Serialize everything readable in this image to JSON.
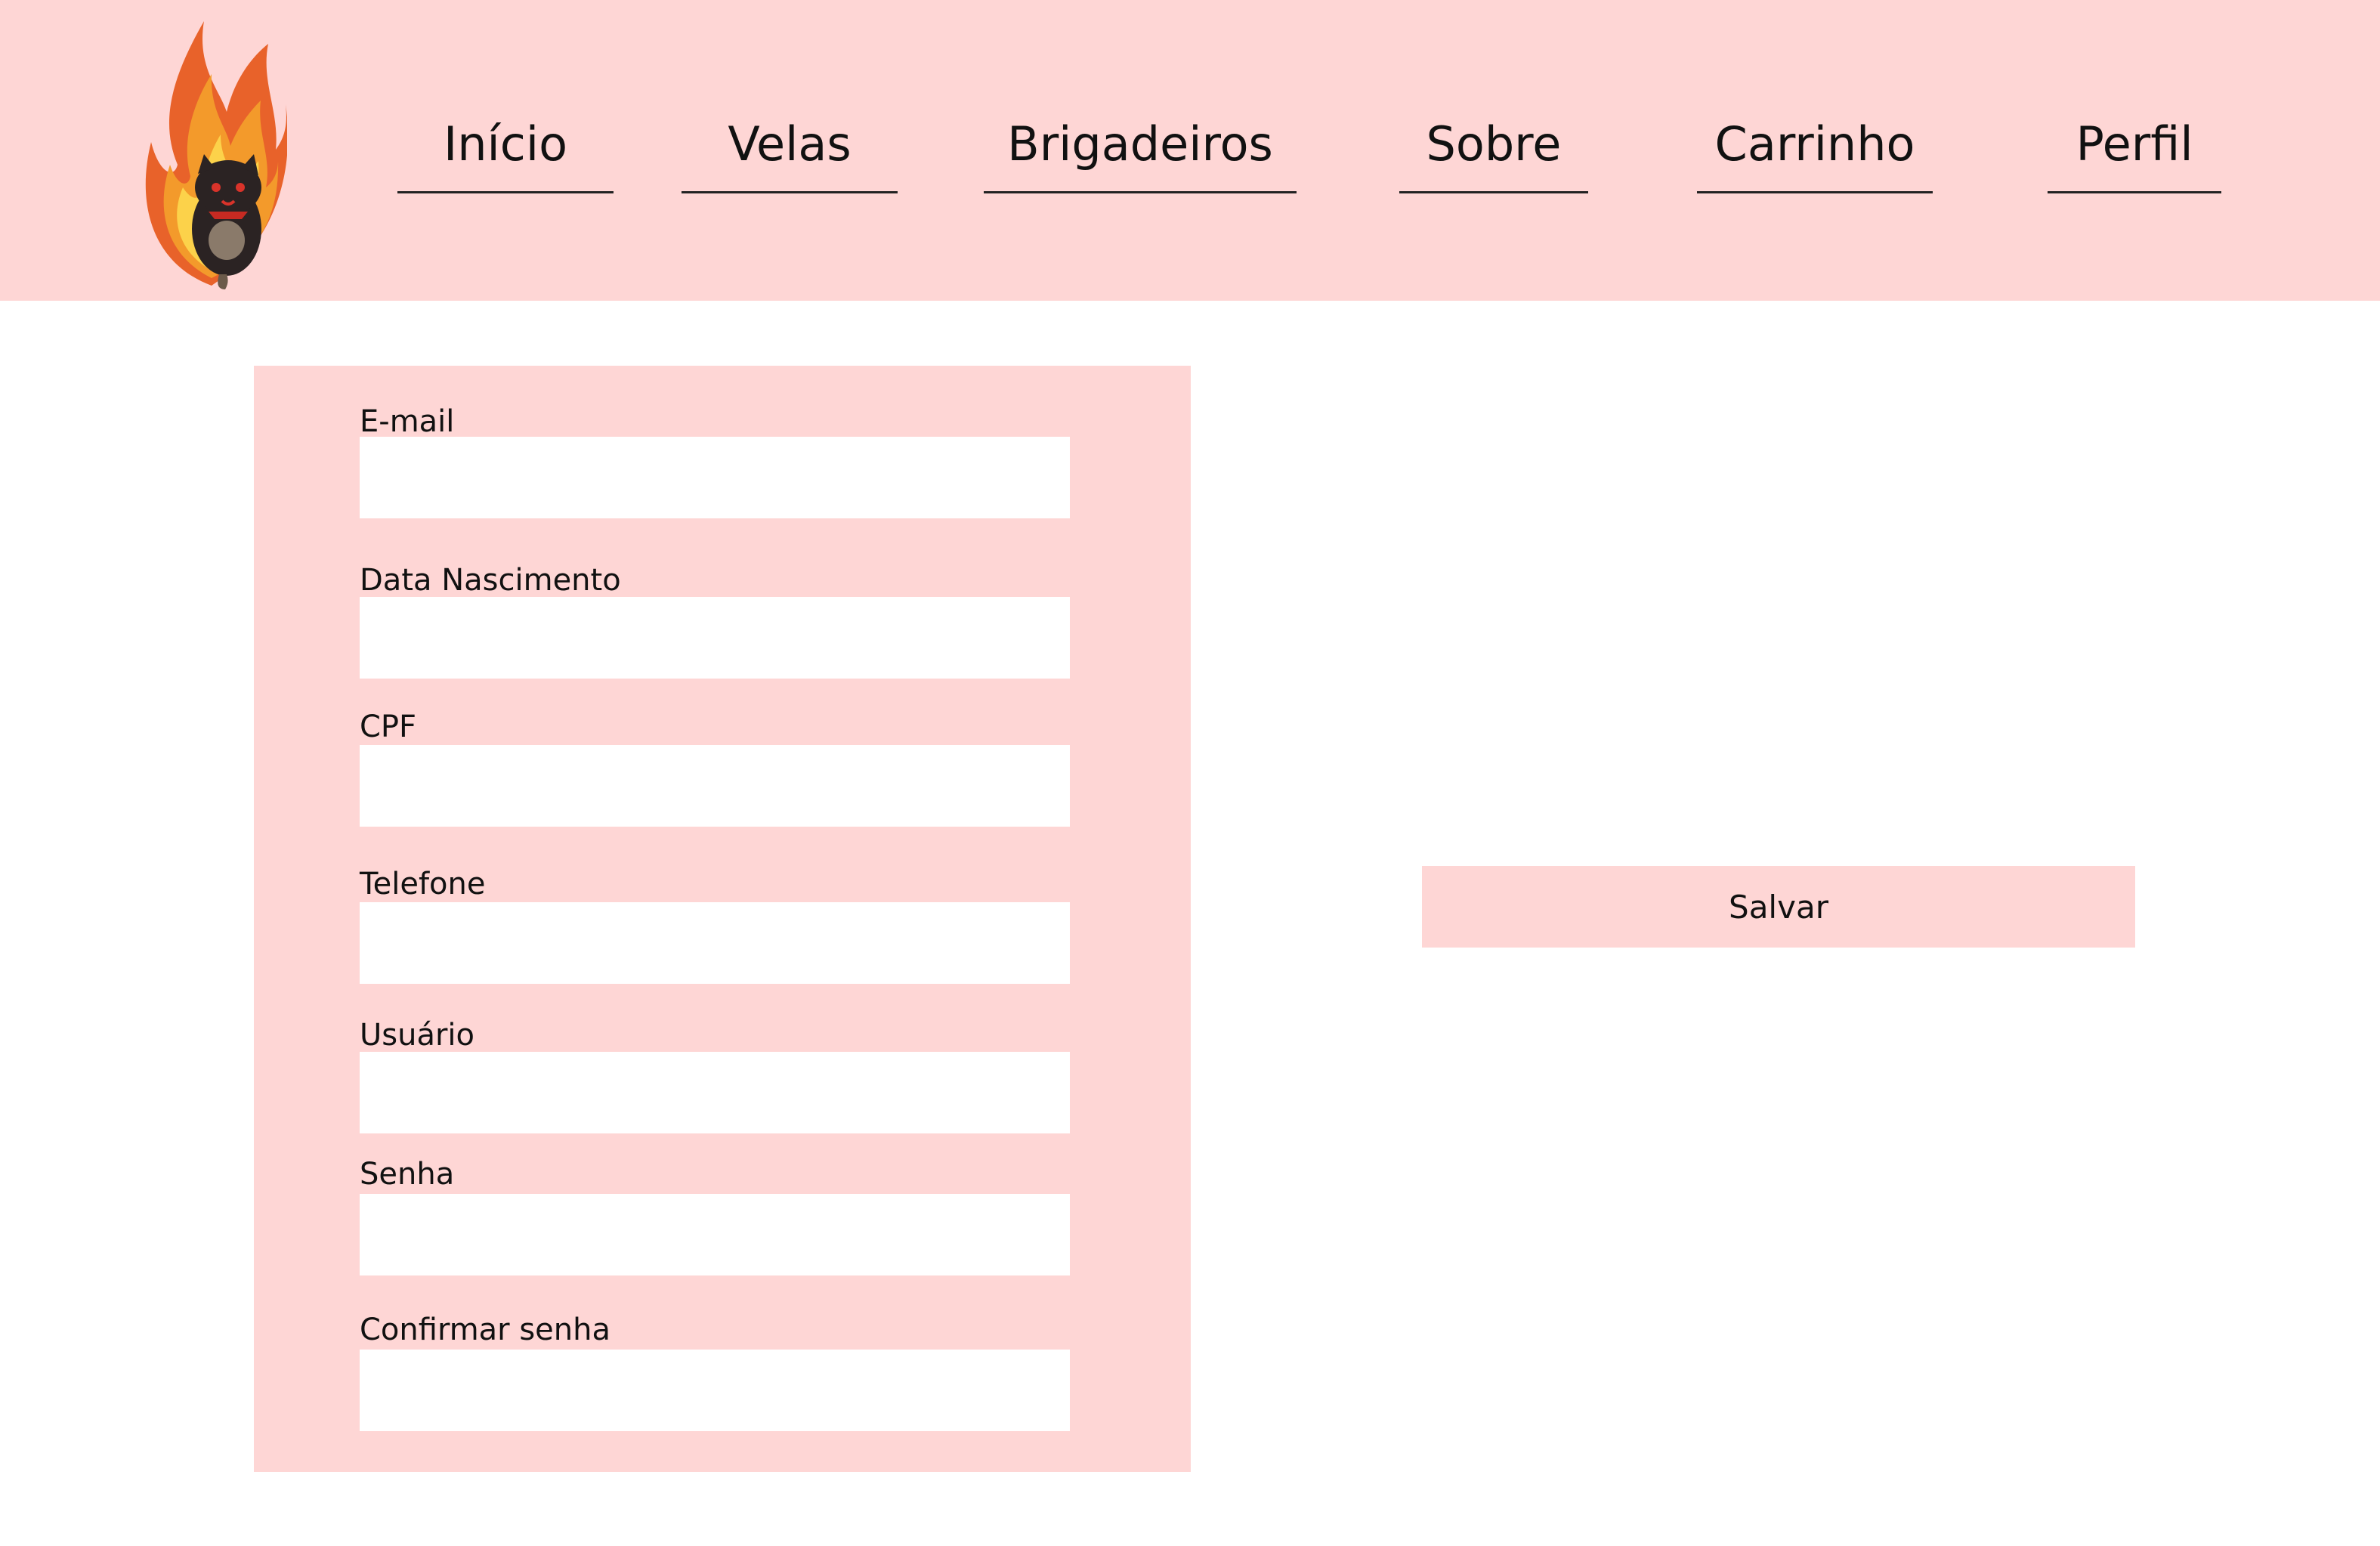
{
  "header": {
    "logo": {
      "icon": "flame-cat-mascot-icon"
    },
    "nav": [
      {
        "label": "Início"
      },
      {
        "label": "Velas"
      },
      {
        "label": "Brigadeiros"
      },
      {
        "label": "Sobre"
      },
      {
        "label": "Carrinho"
      },
      {
        "label": "Perfil"
      }
    ]
  },
  "form": {
    "fields": [
      {
        "label": "E-mail",
        "value": "",
        "placeholder": ""
      },
      {
        "label": "Data Nascimento",
        "value": "",
        "placeholder": ""
      },
      {
        "label": "CPF",
        "value": "",
        "placeholder": ""
      },
      {
        "label": "Telefone",
        "value": "",
        "placeholder": ""
      },
      {
        "label": "Usuário",
        "value": "",
        "placeholder": ""
      },
      {
        "label": "Senha",
        "value": "",
        "placeholder": ""
      },
      {
        "label": "Confirmar senha",
        "value": "",
        "placeholder": ""
      }
    ]
  },
  "actions": {
    "save_label": "Salvar"
  },
  "colors": {
    "header_bg": "#fed6d5",
    "panel_bg": "#fed6d5",
    "button_bg": "#fed6d5",
    "page_bg": "#ffffff",
    "text": "#111111"
  }
}
